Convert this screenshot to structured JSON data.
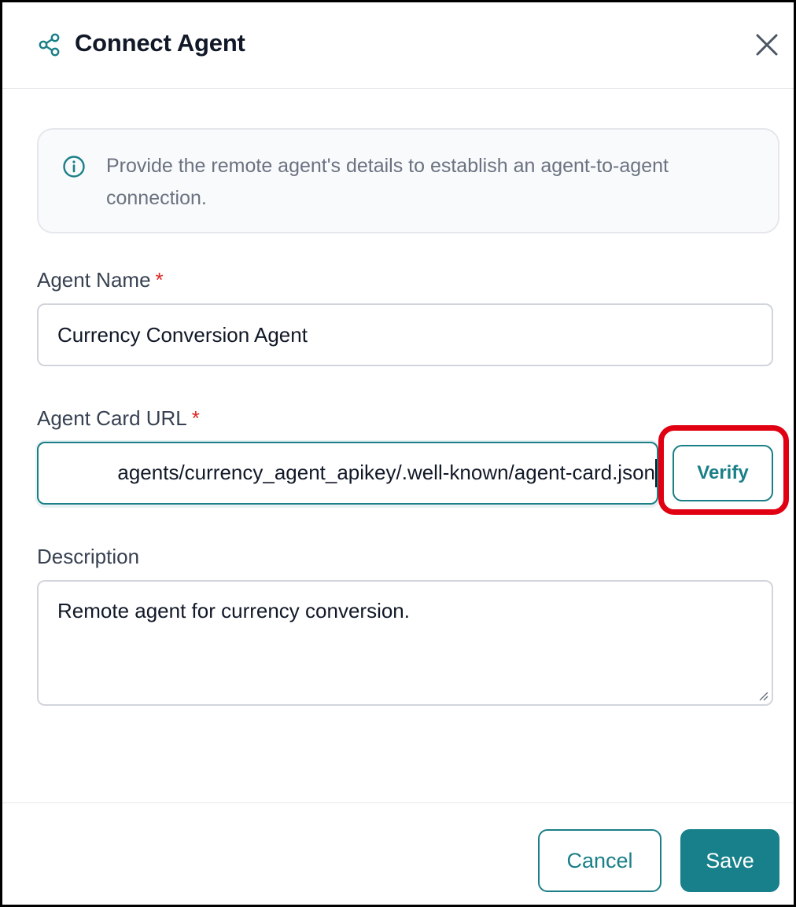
{
  "dialog": {
    "title": "Connect Agent",
    "icons": {
      "header": "share-icon",
      "close": "close-icon",
      "info": "info-icon"
    }
  },
  "info": {
    "text": "Provide the remote agent's details to establish an agent-to-agent connection."
  },
  "form": {
    "agent_name": {
      "label": "Agent Name",
      "required_mark": "*",
      "value": "Currency Conversion Agent"
    },
    "agent_card_url": {
      "label": "Agent Card URL",
      "required_mark": "*",
      "visible_value": "agents/currency_agent_apikey/.well-known/agent-card.json",
      "verify_label": "Verify"
    },
    "description": {
      "label": "Description",
      "value": "Remote agent for currency conversion."
    }
  },
  "footer": {
    "cancel_label": "Cancel",
    "save_label": "Save"
  },
  "colors": {
    "accent": "#17808a",
    "required": "#dc2626",
    "highlight": "#e00012"
  }
}
